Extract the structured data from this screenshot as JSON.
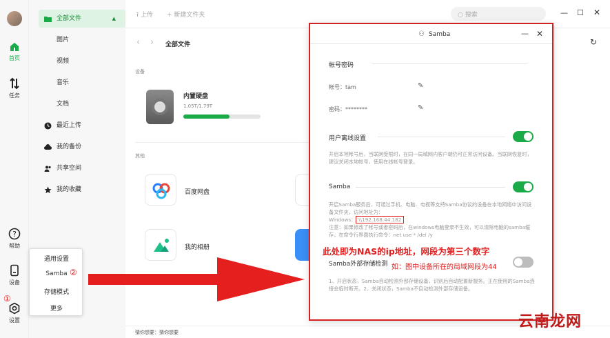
{
  "rail": {
    "items": [
      {
        "label": "首页"
      },
      {
        "label": "任务"
      },
      {
        "label": "帮助"
      },
      {
        "label": "设备"
      },
      {
        "label": "设置"
      }
    ]
  },
  "nav": {
    "all_files": "全部文件",
    "images": "图片",
    "videos": "视频",
    "music": "音乐",
    "docs": "文档",
    "recent": "最近上传",
    "backup": "我的备份",
    "shared": "共享空间",
    "favorites": "我的收藏"
  },
  "toolbar": {
    "upload": "上传",
    "new_folder": "新建文件夹",
    "search_placeholder": "搜索"
  },
  "main": {
    "breadcrumb": "全部文件",
    "devices_label": "设备",
    "disk_name": "内置硬盘",
    "disk_usage": "1.05T/1.79T",
    "disk_fill": 0.6,
    "others_label": "其他",
    "baidu": "百度网盘",
    "album": "我的相册",
    "footer": "猜你想要：猜你想要"
  },
  "dialog": {
    "title": "Samba",
    "account_section": "帐号密码",
    "account_label": "帐号：tam",
    "password_label": "密码：********",
    "offline_title": "用户离线设置",
    "offline_desc": "开启本地帐号后，当联网受限时，在同一局域网内客户端仍可正常访问设备。当联网恢复时，建议关闭本地帐号，使用在线帐号登录。",
    "offline_on": true,
    "samba_title": "Samba",
    "samba_on": true,
    "samba_desc1": "开启Samba服务后，可通过手机、电脑、电视等支持Samba协议的设备在本地网络中访问设备文件夹，访问地址为：",
    "samba_windows_label": "Windows：",
    "samba_ip": "\\\\192.168.44.182",
    "samba_desc2": "注意：如果修改了帐号或者密码后，在windows电脑登录不生效，可以清除电脑的samba缓存，在命令行界面执行命令：net use * /del /y",
    "ext_title": "Samba外部存储检测",
    "ext_on": false,
    "ext_desc": "1、开启状态，Samba自动检测外部存储设备，识别后自动配置新服务。正在使用的Samba连接会临时断开。2、关闭状态，Samba不自动检测外部存储设备。"
  },
  "annotations": {
    "line1": "此处即为NAS的ip地址，网段为第三个数字",
    "line2": "如：图中设备所在的局域网段为44",
    "badge1": "①",
    "badge2": "②",
    "watermark": "云南龙网"
  },
  "settings_menu": {
    "items": [
      "通用设置",
      "Samba",
      "存储模式",
      "更多"
    ]
  },
  "colors": {
    "accent": "#1aaa47",
    "annotation_red": "#e02020"
  }
}
